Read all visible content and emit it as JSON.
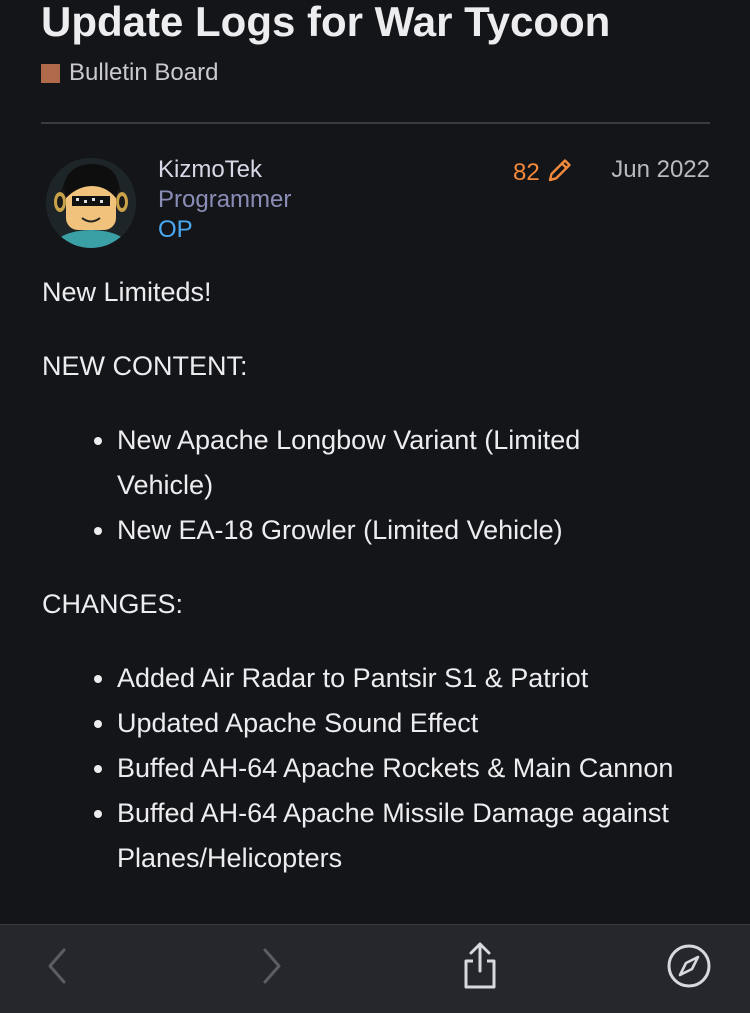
{
  "topic": {
    "title": "Update Logs for War Tycoon",
    "category": "Bulletin Board",
    "category_color": "#b0694a"
  },
  "post": {
    "author": {
      "username": "KizmoTek",
      "title": "Programmer",
      "badge": "OP",
      "avatar_icon": "roblox-avatar-icon"
    },
    "likes": "82",
    "edit_icon": "pencil-icon",
    "date": "Jun 2022",
    "intro": "New Limiteds!",
    "sections": [
      {
        "heading": "NEW CONTENT:",
        "items": [
          "New Apache Longbow Variant (Limited Vehicle)",
          "New EA-18 Growler (Limited Vehicle)"
        ]
      },
      {
        "heading": "CHANGES:",
        "items": [
          "Added Air Radar to Pantsir S1 & Patriot",
          "Updated Apache Sound Effect",
          "Buffed AH-64 Apache Rockets & Main Cannon",
          "Buffed AH-64 Apache Missile Damage against Planes/Helicopters"
        ]
      }
    ]
  },
  "toolbar": {
    "back_icon": "chevron-left-icon",
    "forward_icon": "chevron-right-icon",
    "share_icon": "share-icon",
    "compass_icon": "compass-icon"
  },
  "colors": {
    "background": "#141519",
    "likes": "#f3893a",
    "op_badge": "#4aa8f2",
    "user_title": "#8a8db6",
    "toolbar": "#26272c"
  }
}
